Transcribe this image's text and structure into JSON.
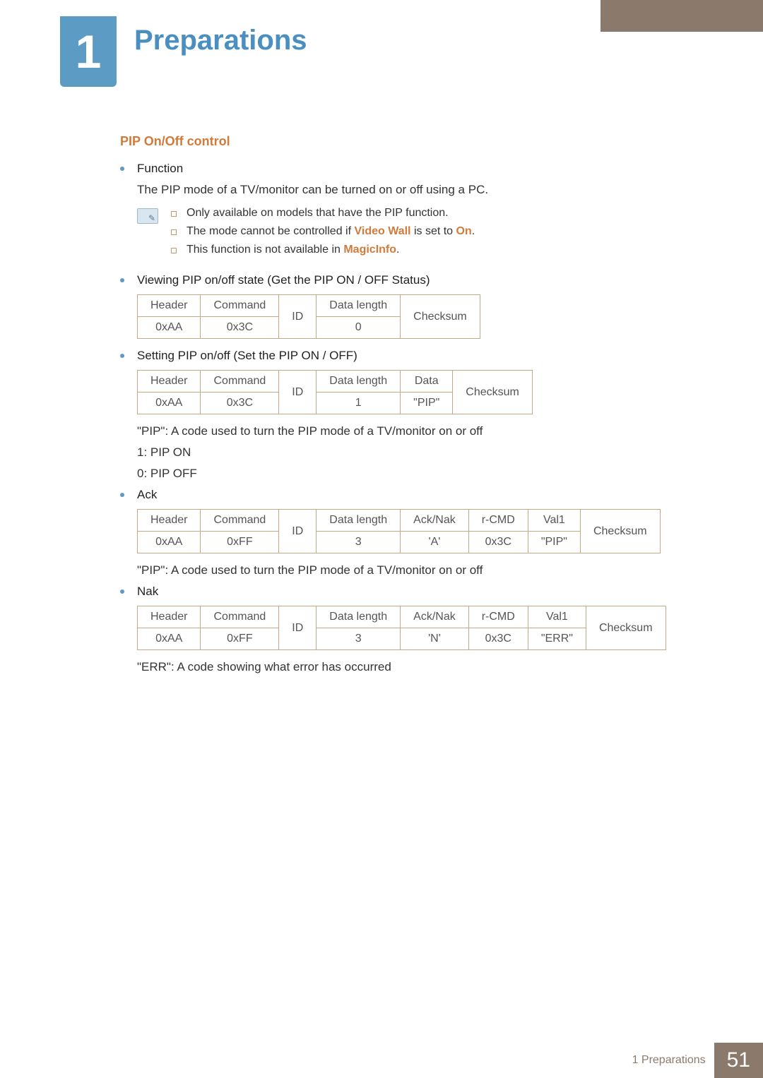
{
  "chapter": {
    "number": "1",
    "title": "Preparations"
  },
  "section": {
    "heading": "PIP On/Off control"
  },
  "function": {
    "label": "Function",
    "desc": "The PIP mode of a TV/monitor can be turned on or off using a PC."
  },
  "notes": {
    "line1": "Only available on models that have the PIP function.",
    "line2a": "The mode cannot be controlled if ",
    "line2_hl1": "Video Wall",
    "line2b": " is set to ",
    "line2_hl2": "On",
    "line2c": ".",
    "line3a": "This function is not available in ",
    "line3_hl": "MagicInfo",
    "line3b": "."
  },
  "viewing": {
    "label": "Viewing PIP on/off state (Get the PIP ON / OFF Status)",
    "headers": {
      "h1": "Header",
      "h2": "Command",
      "h3": "ID",
      "h4": "Data length",
      "h5": "Checksum"
    },
    "values": {
      "v1": "0xAA",
      "v2": "0x3C",
      "v4": "0"
    }
  },
  "setting": {
    "label": "Setting PIP on/off (Set the PIP ON / OFF)",
    "headers": {
      "h1": "Header",
      "h2": "Command",
      "h3": "ID",
      "h4": "Data length",
      "h5": "Data",
      "h6": "Checksum"
    },
    "values": {
      "v1": "0xAA",
      "v2": "0x3C",
      "v4": "1",
      "v5": "\"PIP\""
    },
    "note1": "\"PIP\": A code used to turn the PIP mode of a TV/monitor on or off",
    "note2": "1: PIP ON",
    "note3": "0: PIP OFF"
  },
  "ack": {
    "label": "Ack",
    "headers": {
      "h1": "Header",
      "h2": "Command",
      "h3": "ID",
      "h4": "Data length",
      "h5": "Ack/Nak",
      "h6": "r-CMD",
      "h7": "Val1",
      "h8": "Checksum"
    },
    "values": {
      "v1": "0xAA",
      "v2": "0xFF",
      "v4": "3",
      "v5": "'A'",
      "v6": "0x3C",
      "v7": "\"PIP\""
    },
    "note": "\"PIP\": A code used to turn the PIP mode of a TV/monitor on or off"
  },
  "nak": {
    "label": "Nak",
    "headers": {
      "h1": "Header",
      "h2": "Command",
      "h3": "ID",
      "h4": "Data length",
      "h5": "Ack/Nak",
      "h6": "r-CMD",
      "h7": "Val1",
      "h8": "Checksum"
    },
    "values": {
      "v1": "0xAA",
      "v2": "0xFF",
      "v4": "3",
      "v5": "'N'",
      "v6": "0x3C",
      "v7": "\"ERR\""
    },
    "note": "\"ERR\": A code showing what error has occurred"
  },
  "footer": {
    "text": "1 Preparations",
    "page": "51"
  },
  "chart_data": {
    "type": "table",
    "tables": [
      {
        "title": "Viewing PIP on/off state",
        "columns": [
          "Header",
          "Command",
          "ID",
          "Data length",
          "Checksum"
        ],
        "rows": [
          [
            "0xAA",
            "0x3C",
            "",
            "0",
            ""
          ]
        ]
      },
      {
        "title": "Setting PIP on/off",
        "columns": [
          "Header",
          "Command",
          "ID",
          "Data length",
          "Data",
          "Checksum"
        ],
        "rows": [
          [
            "0xAA",
            "0x3C",
            "",
            "1",
            "\"PIP\"",
            ""
          ]
        ]
      },
      {
        "title": "Ack",
        "columns": [
          "Header",
          "Command",
          "ID",
          "Data length",
          "Ack/Nak",
          "r-CMD",
          "Val1",
          "Checksum"
        ],
        "rows": [
          [
            "0xAA",
            "0xFF",
            "",
            "3",
            "'A'",
            "0x3C",
            "\"PIP\"",
            ""
          ]
        ]
      },
      {
        "title": "Nak",
        "columns": [
          "Header",
          "Command",
          "ID",
          "Data length",
          "Ack/Nak",
          "r-CMD",
          "Val1",
          "Checksum"
        ],
        "rows": [
          [
            "0xAA",
            "0xFF",
            "",
            "3",
            "'N'",
            "0x3C",
            "\"ERR\"",
            ""
          ]
        ]
      }
    ]
  }
}
